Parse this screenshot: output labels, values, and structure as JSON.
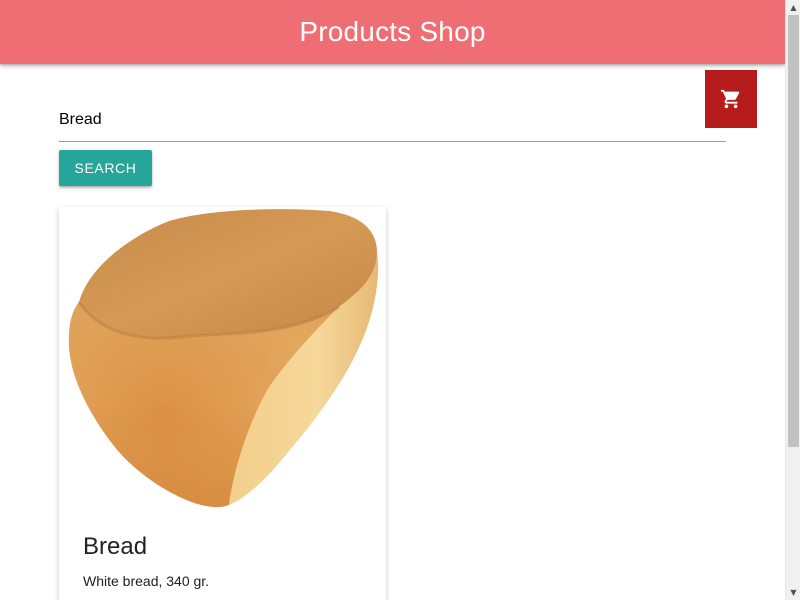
{
  "header": {
    "title": "Products Shop",
    "background": "#ef6e73"
  },
  "cart": {
    "icon": "shopping-cart-icon",
    "background": "#b71c1c"
  },
  "search": {
    "value": "Bread",
    "button_label": "Search",
    "button_color": "#26a69a"
  },
  "products": [
    {
      "name": "Bread",
      "description": "White bread, 340 gr.",
      "image": "bread-loaf-image"
    }
  ],
  "scrollbar": {
    "up_arrow": "▲",
    "down_arrow": "▼"
  }
}
